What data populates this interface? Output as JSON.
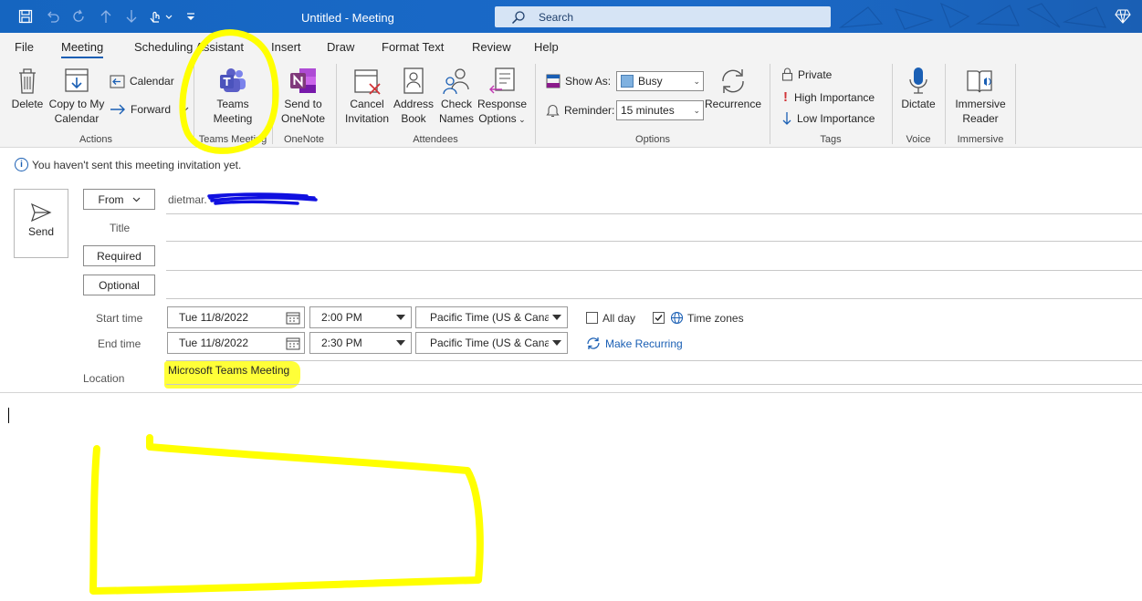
{
  "window": {
    "title": "Untitled  -  Meeting"
  },
  "search": {
    "placeholder": "Search"
  },
  "menu": {
    "tabs": [
      {
        "label": "File"
      },
      {
        "label": "Meeting"
      },
      {
        "label": "Scheduling Assistant"
      },
      {
        "label": "Insert"
      },
      {
        "label": "Draw"
      },
      {
        "label": "Format Text"
      },
      {
        "label": "Review"
      },
      {
        "label": "Help"
      }
    ],
    "active": "Meeting"
  },
  "ribbon": {
    "actions": {
      "delete": "Delete",
      "copy_line1": "Copy to My",
      "copy_line2": "Calendar",
      "calendar": "Calendar",
      "forward": "Forward",
      "group": "Actions"
    },
    "teams": {
      "line1": "Teams",
      "line2": "Meeting",
      "group": "Teams Meeting"
    },
    "onenote": {
      "line1": "Send to",
      "line2": "OneNote",
      "group": "OneNote"
    },
    "attendees": {
      "cancel_line1": "Cancel",
      "cancel_line2": "Invitation",
      "address_line1": "Address",
      "address_line2": "Book",
      "check_line1": "Check",
      "check_line2": "Names",
      "response_line1": "Response",
      "response_line2": "Options",
      "group": "Attendees"
    },
    "options": {
      "show_as_label": "Show As:",
      "show_as_value": "Busy",
      "reminder_label": "Reminder:",
      "reminder_value": "15 minutes",
      "recurrence": "Recurrence",
      "group": "Options"
    },
    "tags": {
      "private": "Private",
      "high": "High Importance",
      "low": "Low Importance",
      "group": "Tags"
    },
    "voice": {
      "dictate": "Dictate",
      "group": "Voice"
    },
    "immersive": {
      "line1": "Immersive",
      "line2": "Reader",
      "group": "Immersive"
    }
  },
  "info": {
    "message": "You haven't sent this meeting invitation yet."
  },
  "form": {
    "send": "Send",
    "from_button": "From",
    "from_value": "dietmar.",
    "title_label": "Title",
    "required_button": "Required",
    "optional_button": "Optional",
    "start_label": "Start time",
    "end_label": "End time",
    "start_date": "Tue 11/8/2022",
    "start_time": "2:00 PM",
    "end_date": "Tue 11/8/2022",
    "end_time": "2:30 PM",
    "timezone_start": "Pacific Time (US & Canada)",
    "timezone_end": "Pacific Time (US & Canada)",
    "all_day": "All day",
    "all_day_checked": false,
    "time_zones": "Time zones",
    "time_zones_checked": true,
    "make_recurring": "Make Recurring",
    "location_label": "Location",
    "location_value": "Microsoft Teams Meeting"
  },
  "colors": {
    "titlebar": "#1565c0",
    "accent": "#1a5fb4",
    "highlight": "#ffff38",
    "redaction": "#1010e0"
  }
}
